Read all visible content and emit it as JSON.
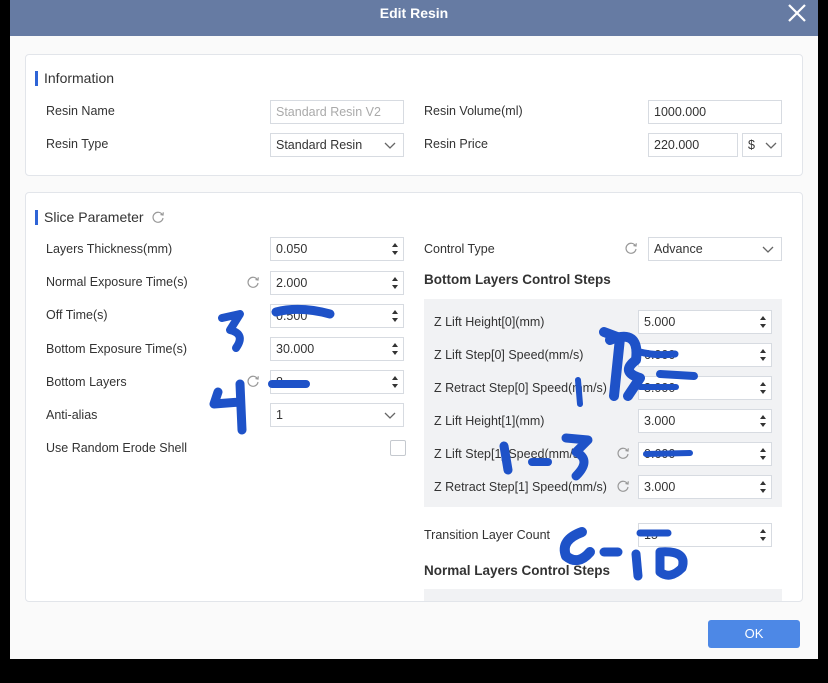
{
  "dialog": {
    "title": "Edit Resin",
    "ok_label": "OK"
  },
  "information": {
    "heading": "Information",
    "resin_name_label": "Resin Name",
    "resin_name_value": "Standard Resin V2",
    "resin_type_label": "Resin Type",
    "resin_type_value": "Standard Resin",
    "resin_volume_label": "Resin Volume(ml)",
    "resin_volume_value": "1000.000",
    "resin_price_label": "Resin Price",
    "resin_price_value": "220.000",
    "currency_value": "$"
  },
  "slice": {
    "heading": "Slice Parameter",
    "layers_thickness_label": "Layers Thickness(mm)",
    "layers_thickness_value": "0.050",
    "normal_exposure_label": "Normal Exposure Time(s)",
    "normal_exposure_value": "2.000",
    "off_time_label": "Off Time(s)",
    "off_time_value": "0.500",
    "bottom_exposure_label": "Bottom Exposure Time(s)",
    "bottom_exposure_value": "30.000",
    "bottom_layers_label": "Bottom Layers",
    "bottom_layers_value": "8",
    "anti_alias_label": "Anti-alias",
    "anti_alias_value": "1",
    "random_erode_label": "Use Random Erode Shell",
    "control_type_label": "Control Type",
    "control_type_value": "Advance",
    "bottom_steps_heading": "Bottom Layers Control Steps",
    "z_lift_height_0_label": "Z Lift Height[0](mm)",
    "z_lift_height_0_value": "5.000",
    "z_lift_speed_0_label": "Z Lift Step[0] Speed(mm/s)",
    "z_lift_speed_0_value": "6.000",
    "z_retract_speed_0_label": "Z Retract Step[0] Speed(mm/s)",
    "z_retract_speed_0_value": "3.000",
    "z_lift_height_1_label": "Z Lift Height[1](mm)",
    "z_lift_height_1_value": "3.000",
    "z_lift_speed_1_label": "Z Lift Step[1] Speed(mm/s)",
    "z_lift_speed_1_value": "0.600",
    "z_retract_speed_1_label": "Z Retract Step[1] Speed(mm/s)",
    "z_retract_speed_1_value": "3.000",
    "transition_layer_label": "Transition Layer Count",
    "transition_layer_value": "15",
    "normal_steps_heading": "Normal Layers Control Steps"
  },
  "colors": {
    "title_bar": "#667ba3",
    "accent": "#2e64d6",
    "ok_button": "#4d88e6",
    "annotation_ink": "#1e52c8"
  }
}
